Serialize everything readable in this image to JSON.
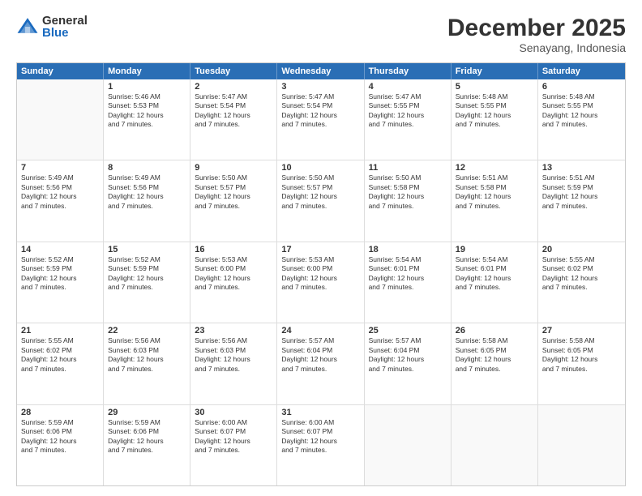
{
  "logo": {
    "general": "General",
    "blue": "Blue"
  },
  "title": "December 2025",
  "location": "Senayang, Indonesia",
  "header": {
    "days": [
      "Sunday",
      "Monday",
      "Tuesday",
      "Wednesday",
      "Thursday",
      "Friday",
      "Saturday"
    ]
  },
  "weeks": [
    [
      {
        "day": "",
        "info": ""
      },
      {
        "day": "1",
        "info": "Sunrise: 5:46 AM\nSunset: 5:53 PM\nDaylight: 12 hours\nand 7 minutes."
      },
      {
        "day": "2",
        "info": "Sunrise: 5:47 AM\nSunset: 5:54 PM\nDaylight: 12 hours\nand 7 minutes."
      },
      {
        "day": "3",
        "info": "Sunrise: 5:47 AM\nSunset: 5:54 PM\nDaylight: 12 hours\nand 7 minutes."
      },
      {
        "day": "4",
        "info": "Sunrise: 5:47 AM\nSunset: 5:55 PM\nDaylight: 12 hours\nand 7 minutes."
      },
      {
        "day": "5",
        "info": "Sunrise: 5:48 AM\nSunset: 5:55 PM\nDaylight: 12 hours\nand 7 minutes."
      },
      {
        "day": "6",
        "info": "Sunrise: 5:48 AM\nSunset: 5:55 PM\nDaylight: 12 hours\nand 7 minutes."
      }
    ],
    [
      {
        "day": "7",
        "info": "Sunrise: 5:49 AM\nSunset: 5:56 PM\nDaylight: 12 hours\nand 7 minutes."
      },
      {
        "day": "8",
        "info": "Sunrise: 5:49 AM\nSunset: 5:56 PM\nDaylight: 12 hours\nand 7 minutes."
      },
      {
        "day": "9",
        "info": "Sunrise: 5:50 AM\nSunset: 5:57 PM\nDaylight: 12 hours\nand 7 minutes."
      },
      {
        "day": "10",
        "info": "Sunrise: 5:50 AM\nSunset: 5:57 PM\nDaylight: 12 hours\nand 7 minutes."
      },
      {
        "day": "11",
        "info": "Sunrise: 5:50 AM\nSunset: 5:58 PM\nDaylight: 12 hours\nand 7 minutes."
      },
      {
        "day": "12",
        "info": "Sunrise: 5:51 AM\nSunset: 5:58 PM\nDaylight: 12 hours\nand 7 minutes."
      },
      {
        "day": "13",
        "info": "Sunrise: 5:51 AM\nSunset: 5:59 PM\nDaylight: 12 hours\nand 7 minutes."
      }
    ],
    [
      {
        "day": "14",
        "info": "Sunrise: 5:52 AM\nSunset: 5:59 PM\nDaylight: 12 hours\nand 7 minutes."
      },
      {
        "day": "15",
        "info": "Sunrise: 5:52 AM\nSunset: 5:59 PM\nDaylight: 12 hours\nand 7 minutes."
      },
      {
        "day": "16",
        "info": "Sunrise: 5:53 AM\nSunset: 6:00 PM\nDaylight: 12 hours\nand 7 minutes."
      },
      {
        "day": "17",
        "info": "Sunrise: 5:53 AM\nSunset: 6:00 PM\nDaylight: 12 hours\nand 7 minutes."
      },
      {
        "day": "18",
        "info": "Sunrise: 5:54 AM\nSunset: 6:01 PM\nDaylight: 12 hours\nand 7 minutes."
      },
      {
        "day": "19",
        "info": "Sunrise: 5:54 AM\nSunset: 6:01 PM\nDaylight: 12 hours\nand 7 minutes."
      },
      {
        "day": "20",
        "info": "Sunrise: 5:55 AM\nSunset: 6:02 PM\nDaylight: 12 hours\nand 7 minutes."
      }
    ],
    [
      {
        "day": "21",
        "info": "Sunrise: 5:55 AM\nSunset: 6:02 PM\nDaylight: 12 hours\nand 7 minutes."
      },
      {
        "day": "22",
        "info": "Sunrise: 5:56 AM\nSunset: 6:03 PM\nDaylight: 12 hours\nand 7 minutes."
      },
      {
        "day": "23",
        "info": "Sunrise: 5:56 AM\nSunset: 6:03 PM\nDaylight: 12 hours\nand 7 minutes."
      },
      {
        "day": "24",
        "info": "Sunrise: 5:57 AM\nSunset: 6:04 PM\nDaylight: 12 hours\nand 7 minutes."
      },
      {
        "day": "25",
        "info": "Sunrise: 5:57 AM\nSunset: 6:04 PM\nDaylight: 12 hours\nand 7 minutes."
      },
      {
        "day": "26",
        "info": "Sunrise: 5:58 AM\nSunset: 6:05 PM\nDaylight: 12 hours\nand 7 minutes."
      },
      {
        "day": "27",
        "info": "Sunrise: 5:58 AM\nSunset: 6:05 PM\nDaylight: 12 hours\nand 7 minutes."
      }
    ],
    [
      {
        "day": "28",
        "info": "Sunrise: 5:59 AM\nSunset: 6:06 PM\nDaylight: 12 hours\nand 7 minutes."
      },
      {
        "day": "29",
        "info": "Sunrise: 5:59 AM\nSunset: 6:06 PM\nDaylight: 12 hours\nand 7 minutes."
      },
      {
        "day": "30",
        "info": "Sunrise: 6:00 AM\nSunset: 6:07 PM\nDaylight: 12 hours\nand 7 minutes."
      },
      {
        "day": "31",
        "info": "Sunrise: 6:00 AM\nSunset: 6:07 PM\nDaylight: 12 hours\nand 7 minutes."
      },
      {
        "day": "",
        "info": ""
      },
      {
        "day": "",
        "info": ""
      },
      {
        "day": "",
        "info": ""
      }
    ]
  ]
}
